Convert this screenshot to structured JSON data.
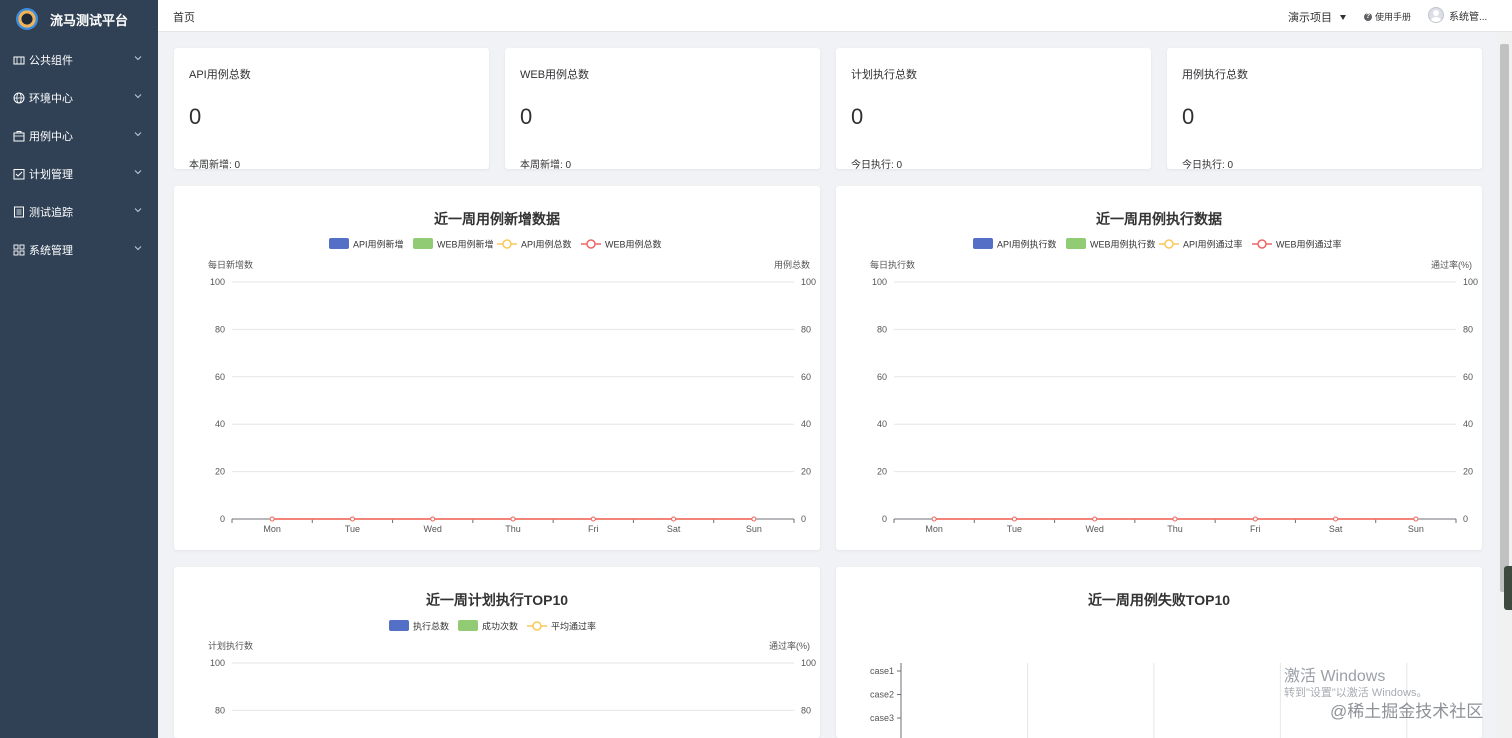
{
  "app": {
    "title": "流马测试平台"
  },
  "sidebar": {
    "items": [
      {
        "label": "公共组件",
        "icon": "component-icon"
      },
      {
        "label": "环境中心",
        "icon": "globe-icon"
      },
      {
        "label": "用例中心",
        "icon": "box-icon"
      },
      {
        "label": "计划管理",
        "icon": "checklist-icon"
      },
      {
        "label": "测试追踪",
        "icon": "document-icon"
      },
      {
        "label": "系统管理",
        "icon": "grid-icon"
      }
    ]
  },
  "header": {
    "breadcrumb": "首页",
    "project": "演示项目",
    "help": "使用手册",
    "user": "系统管..."
  },
  "stats": [
    {
      "label": "API用例总数",
      "value": "0",
      "foot": "本周新增: 0"
    },
    {
      "label": "WEB用例总数",
      "value": "0",
      "foot": "本周新增: 0"
    },
    {
      "label": "计划执行总数",
      "value": "0",
      "foot": "今日执行: 0"
    },
    {
      "label": "用例执行总数",
      "value": "0",
      "foot": "今日执行: 0"
    }
  ],
  "colors": {
    "blue": "#5470c6",
    "green": "#91cc75",
    "yellow": "#fac858",
    "red": "#ee6666",
    "sidebar": "#304156"
  },
  "chart_data": [
    {
      "type": "bar",
      "title": "近一周用例新增数据",
      "categories": [
        "Mon",
        "Tue",
        "Wed",
        "Thu",
        "Fri",
        "Sat",
        "Sun"
      ],
      "ylabel": "每日新增数",
      "y2label": "用例总数",
      "ylim": [
        0,
        100
      ],
      "yticks": [
        "0",
        "20",
        "40",
        "60",
        "80",
        "100"
      ],
      "y2ticks": [
        "0",
        "20",
        "40",
        "60",
        "80",
        "100"
      ],
      "grid": true,
      "legend_position": "top-center",
      "series": [
        {
          "name": "API用例新增",
          "kind": "bar",
          "color": "#5470c6",
          "values": [
            0,
            0,
            0,
            0,
            0,
            0,
            0
          ]
        },
        {
          "name": "WEB用例新增",
          "kind": "bar",
          "color": "#91cc75",
          "values": [
            0,
            0,
            0,
            0,
            0,
            0,
            0
          ]
        },
        {
          "name": "API用例总数",
          "kind": "line",
          "color": "#fac858",
          "values": [
            0,
            0,
            0,
            0,
            0,
            0,
            0
          ]
        },
        {
          "name": "WEB用例总数",
          "kind": "line",
          "color": "#ee6666",
          "values": [
            0,
            0,
            0,
            0,
            0,
            0,
            0
          ]
        }
      ]
    },
    {
      "type": "bar",
      "title": "近一周用例执行数据",
      "categories": [
        "Mon",
        "Tue",
        "Wed",
        "Thu",
        "Fri",
        "Sat",
        "Sun"
      ],
      "ylabel": "每日执行数",
      "y2label": "通过率(%)",
      "ylim": [
        0,
        100
      ],
      "yticks": [
        "0",
        "20",
        "40",
        "60",
        "80",
        "100"
      ],
      "y2ticks": [
        "0",
        "20",
        "40",
        "60",
        "80",
        "100"
      ],
      "grid": true,
      "legend_position": "top-center",
      "series": [
        {
          "name": "API用例执行数",
          "kind": "bar",
          "color": "#5470c6",
          "values": [
            0,
            0,
            0,
            0,
            0,
            0,
            0
          ]
        },
        {
          "name": "WEB用例执行数",
          "kind": "bar",
          "color": "#91cc75",
          "values": [
            0,
            0,
            0,
            0,
            0,
            0,
            0
          ]
        },
        {
          "name": "API用例通过率",
          "kind": "line",
          "color": "#fac858",
          "values": [
            0,
            0,
            0,
            0,
            0,
            0,
            0
          ]
        },
        {
          "name": "WEB用例通过率",
          "kind": "line",
          "color": "#ee6666",
          "values": [
            0,
            0,
            0,
            0,
            0,
            0,
            0
          ]
        }
      ]
    },
    {
      "type": "bar",
      "title": "近一周计划执行TOP10",
      "categories": [],
      "ylabel": "计划执行数",
      "y2label": "通过率(%)",
      "ylim": [
        0,
        100
      ],
      "yticks": [
        "100",
        "80"
      ],
      "y2ticks": [
        "100",
        "80"
      ],
      "grid": true,
      "legend_position": "top-center",
      "series": [
        {
          "name": "执行总数",
          "kind": "bar",
          "color": "#5470c6",
          "values": []
        },
        {
          "name": "成功次数",
          "kind": "bar",
          "color": "#91cc75",
          "values": []
        },
        {
          "name": "平均通过率",
          "kind": "line",
          "color": "#fac858",
          "values": []
        }
      ]
    },
    {
      "type": "bar",
      "title": "近一周用例失败TOP10",
      "orientation": "horizontal",
      "categories": [
        "case1",
        "case2",
        "case3"
      ],
      "series": [],
      "grid": true
    }
  ],
  "watermark": {
    "activate_title": "激活 Windows",
    "activate_sub": "转到\"设置\"以激活 Windows。",
    "site": "@稀土掘金技术社区"
  }
}
